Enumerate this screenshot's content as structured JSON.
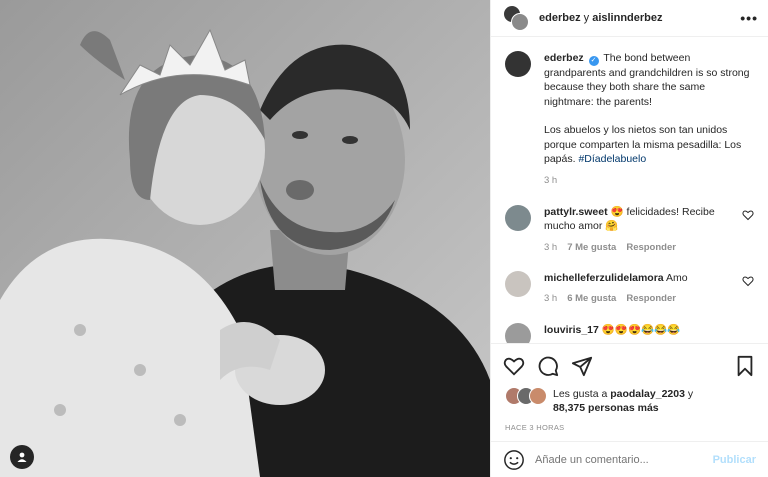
{
  "header": {
    "user1": "ederbez",
    "connector": "y",
    "user2": "aislinnderbez",
    "more_label": "•••"
  },
  "caption": {
    "username": "ederbez",
    "verified_glyph": "✓",
    "text_en": "The bond between grandparents and grandchildren is so strong because they both share the same nightmare: the parents!",
    "text_es": "Los abuelos y los nietos son tan unidos porque comparten la misma pesadilla: Los papás.",
    "hashtag": "#Díadelabuelo",
    "time": "3 h"
  },
  "comments": [
    {
      "username": "pattylr.sweet",
      "text": "😍 felicidades! Recibe mucho amor 🤗",
      "time": "3 h",
      "likes": "7 Me gusta",
      "reply": "Responder"
    },
    {
      "username": "michelleferzulidelamora",
      "text": "Amo",
      "time": "3 h",
      "likes": "6 Me gusta",
      "reply": "Responder"
    },
    {
      "username": "louviris_17",
      "text": "😍😍😍😂😂😂"
    }
  ],
  "likes": {
    "prefix": "Les gusta a",
    "user": "paodalay_2203",
    "connector": "y",
    "count": "88,375 personas más"
  },
  "posted_ago": "HACE 3 HORAS",
  "add_comment": {
    "placeholder": "Añade un comentario...",
    "publish": "Publicar"
  },
  "colors": {
    "link_blue": "#00376b",
    "verified_blue": "#3897f0",
    "publish_disabled": "#b2dffc",
    "muted": "#8e8e8e"
  }
}
